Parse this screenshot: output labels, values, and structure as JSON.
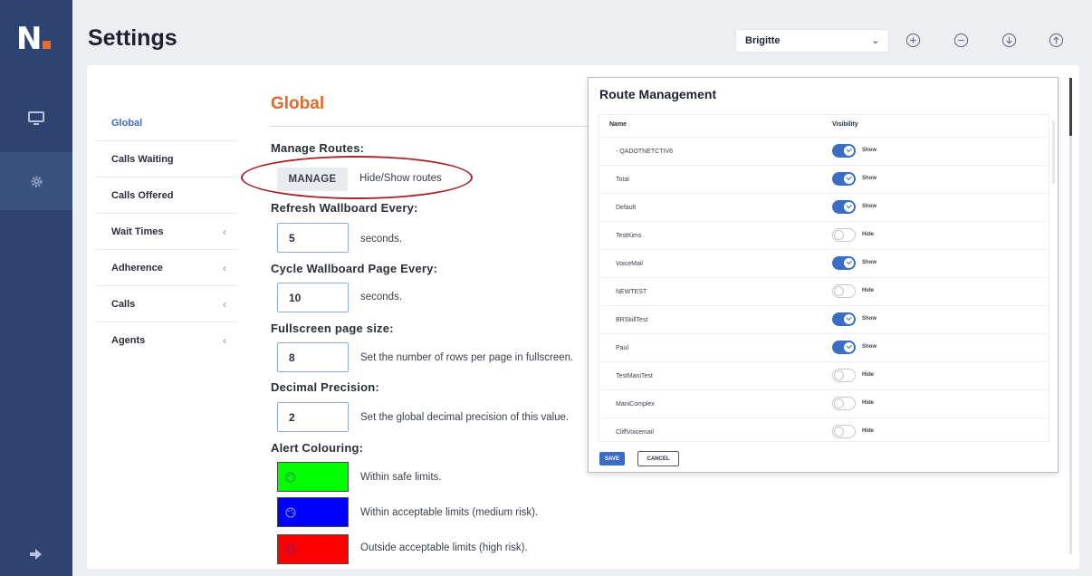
{
  "app": {
    "logo_text": "N",
    "page_title": "Settings"
  },
  "colors": {
    "rail": "#2f4370",
    "accent": "#3b6dc7",
    "section_title": "#e0692b",
    "brand_dot": "#f26a21",
    "highlight_ellipse": "#a3262a"
  },
  "rail": {
    "items": [
      {
        "icon": "monitor-icon",
        "active": false
      },
      {
        "icon": "gear-icon",
        "active": true
      }
    ],
    "bottom_icon": "sign-out-icon"
  },
  "header": {
    "user_selected": "Brigitte",
    "icons": [
      "zoom-in-icon",
      "zoom-out-icon",
      "download-icon",
      "upload-icon"
    ]
  },
  "nav": {
    "items": [
      {
        "label": "Global",
        "active": true,
        "expandable": false
      },
      {
        "label": "Calls Waiting",
        "active": false,
        "expandable": false
      },
      {
        "label": "Calls Offered",
        "active": false,
        "expandable": false
      },
      {
        "label": "Wait Times",
        "active": false,
        "expandable": true
      },
      {
        "label": "Adherence",
        "active": false,
        "expandable": true
      },
      {
        "label": "Calls",
        "active": false,
        "expandable": true
      },
      {
        "label": "Agents",
        "active": false,
        "expandable": true
      }
    ],
    "caret": "‹"
  },
  "global": {
    "title": "Global",
    "manage_routes_label": "Manage Routes:",
    "manage_button": "MANAGE",
    "manage_hint": "Hide/Show routes",
    "refresh_label": "Refresh Wallboard Every:",
    "refresh_value": "5",
    "refresh_unit": "seconds.",
    "cycle_label": "Cycle Wallboard Page Every:",
    "cycle_value": "10",
    "cycle_unit": "seconds.",
    "fullscreen_label": "Fullscreen page size:",
    "fullscreen_value": "8",
    "fullscreen_hint": "Set the number of rows per page in fullscreen.",
    "decimal_label": "Decimal Precision:",
    "decimal_value": "2",
    "decimal_hint": "Set the global decimal precision of this value.",
    "alert_label": "Alert Colouring:",
    "alerts": [
      {
        "color": "#00ff00",
        "text": "Within safe limits.",
        "icon": "palette-icon"
      },
      {
        "color": "#0000ff",
        "text": "Within acceptable limits (medium risk).",
        "icon": "palette-icon"
      },
      {
        "color": "#ff0000",
        "text": "Outside acceptable limits (high risk).",
        "icon": "palette-icon"
      }
    ]
  },
  "route_modal": {
    "title": "Route Management",
    "col_name": "Name",
    "col_visibility": "Visibility",
    "rows": [
      {
        "name": "- QADOTNETCTIV6",
        "visible": true,
        "label": "Show"
      },
      {
        "name": "Total",
        "visible": true,
        "label": "Show"
      },
      {
        "name": "Default",
        "visible": true,
        "label": "Show"
      },
      {
        "name": "TestKims",
        "visible": false,
        "label": "Hide"
      },
      {
        "name": "VoiceMail",
        "visible": true,
        "label": "Show"
      },
      {
        "name": "NEWTEST",
        "visible": false,
        "label": "Hide"
      },
      {
        "name": "BRSkillTest",
        "visible": true,
        "label": "Show"
      },
      {
        "name": "Paul",
        "visible": true,
        "label": "Show"
      },
      {
        "name": "TestManiTest",
        "visible": false,
        "label": "Hide"
      },
      {
        "name": "ManiComplex",
        "visible": false,
        "label": "Hide"
      },
      {
        "name": "CliffVoicemail",
        "visible": false,
        "label": "Hide"
      }
    ],
    "save_label": "SAVE",
    "cancel_label": "CANCEL"
  }
}
